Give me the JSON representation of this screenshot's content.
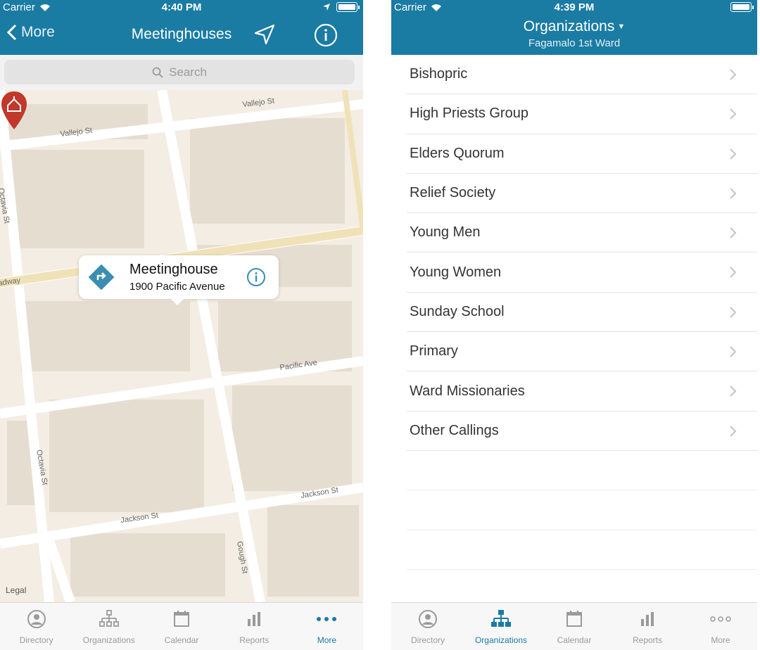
{
  "left": {
    "status": {
      "carrier": "Carrier",
      "time": "4:40 PM"
    },
    "nav": {
      "back_label": "More",
      "title": "Meetinghouses"
    },
    "search": {
      "placeholder": "Search"
    },
    "map": {
      "streets": [
        "Vallejo St",
        "Vallejo St",
        "Octavia St",
        "adway",
        "Pacific Ave",
        "Octavia St",
        "Jackson St",
        "Jackson St",
        "Gough St"
      ],
      "callout": {
        "title": "Meetinghouse",
        "address": "1900 Pacific Avenue"
      },
      "legal": "Legal"
    },
    "tabs": [
      "Directory",
      "Organizations",
      "Calendar",
      "Reports",
      "More"
    ],
    "active_tab": "More"
  },
  "right": {
    "status": {
      "carrier": "Carrier",
      "time": "4:39 PM"
    },
    "nav": {
      "title": "Organizations",
      "subtitle": "Fagamalo 1st Ward"
    },
    "organizations": [
      "Bishopric",
      "High Priests Group",
      "Elders Quorum",
      "Relief Society",
      "Young Men",
      "Young Women",
      "Sunday School",
      "Primary",
      "Ward Missionaries",
      "Other Callings"
    ],
    "tabs": [
      "Directory",
      "Organizations",
      "Calendar",
      "Reports",
      "More"
    ],
    "active_tab": "Organizations"
  },
  "colors": {
    "accent": "#1a7ba3",
    "pin": "#c0392b",
    "directions": "#3a8fb0"
  }
}
